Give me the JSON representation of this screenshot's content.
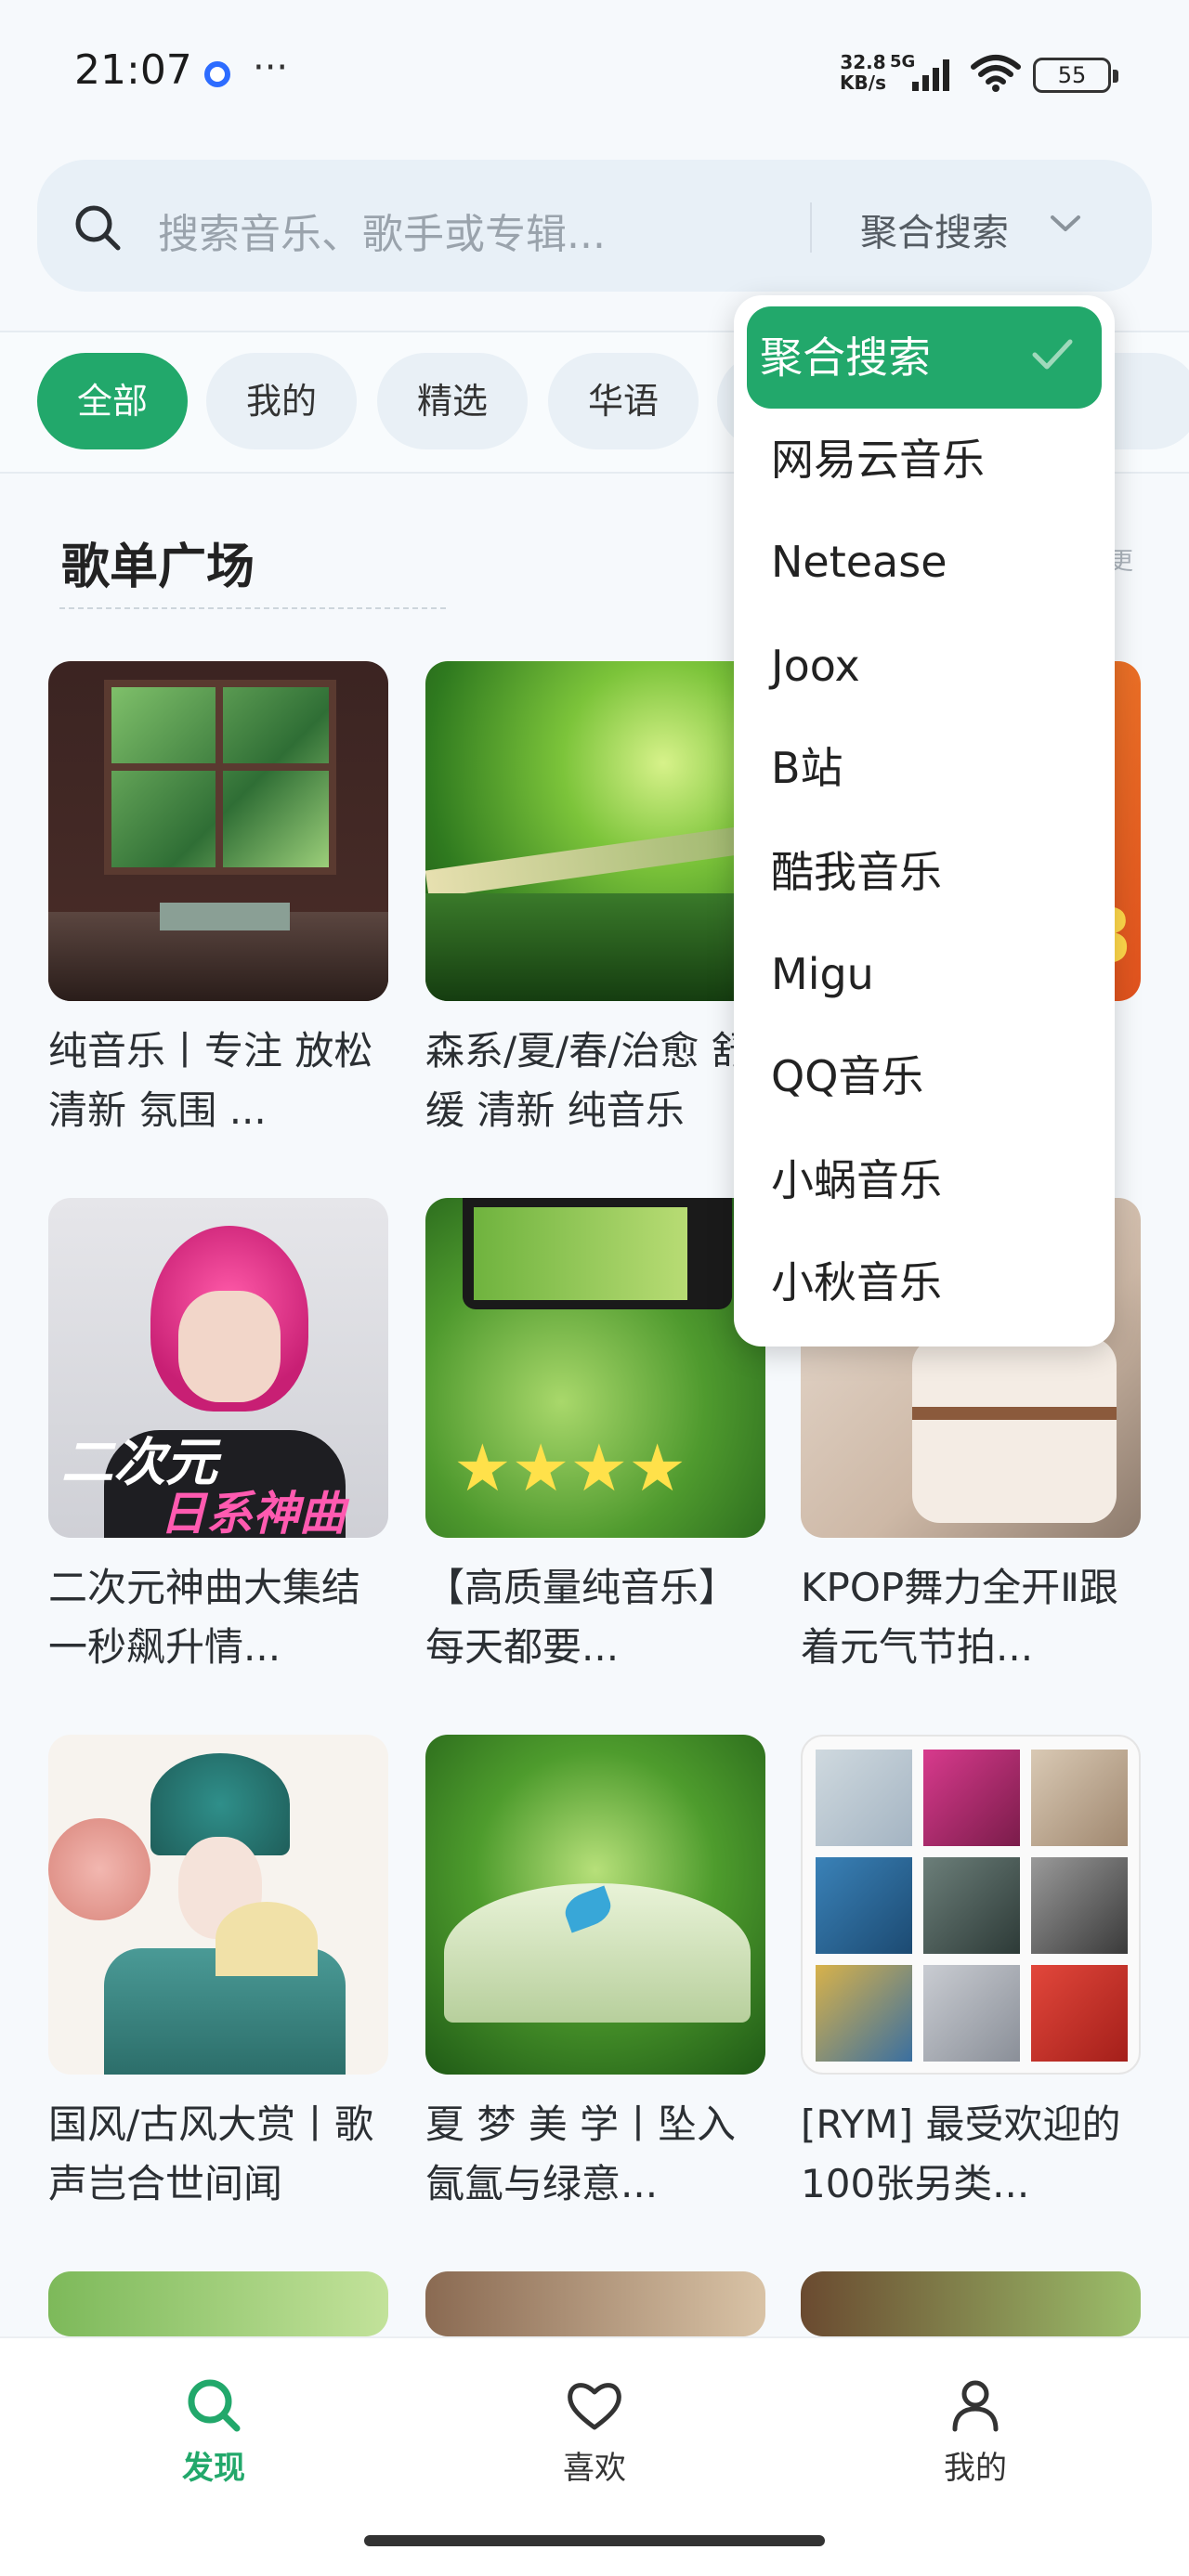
{
  "status_bar": {
    "time": "21:07",
    "dots": "···",
    "net_speed_value": "32.8",
    "net_speed_unit": "KB/s",
    "network": "5G",
    "battery": "55"
  },
  "search": {
    "placeholder": "搜索音乐、歌手或专辑...",
    "mode_label": "聚合搜索"
  },
  "tabs": [
    {
      "label": "全部",
      "active": true
    },
    {
      "label": "我的"
    },
    {
      "label": "精选"
    },
    {
      "label": "华语"
    },
    {
      "label": ""
    },
    {
      "label": ""
    }
  ],
  "section": {
    "title": "歌单广场",
    "more": "更"
  },
  "playlists": [
    {
      "title": "纯音乐丨专注 放松 清新 氛围 ..."
    },
    {
      "title": "森系/夏/春/治愈 舒缓 清新 纯音乐"
    },
    {
      "title": ""
    },
    {
      "title": "二次元神曲大集结 一秒飙升情...",
      "overlay_line1": "二次元",
      "overlay_line2": "日系神曲"
    },
    {
      "title": "【高质量纯音乐】每天都要..."
    },
    {
      "title": "KPOP舞力全开Ⅱ跟着元气节拍..."
    },
    {
      "title": "国风/古风大赏丨歌声岂合世间闻"
    },
    {
      "title": "夏 梦 美 学丨坠入氤氲与绿意..."
    },
    {
      "title": "[RYM] 最受欢迎的100张另类..."
    }
  ],
  "dropdown": {
    "items": [
      "聚合搜索",
      "网易云音乐",
      "Netease",
      "Joox",
      "B站",
      "酷我音乐",
      "Migu",
      "QQ音乐",
      "小蜗音乐",
      "小秋音乐"
    ],
    "selected": "聚合搜索"
  },
  "bottom_nav": [
    {
      "label": "发现",
      "icon": "search-icon",
      "active": true
    },
    {
      "label": "喜欢",
      "icon": "heart-icon"
    },
    {
      "label": "我的",
      "icon": "person-icon"
    }
  ],
  "colors": {
    "accent": "#22a86b",
    "background": "#f6f9fc"
  }
}
